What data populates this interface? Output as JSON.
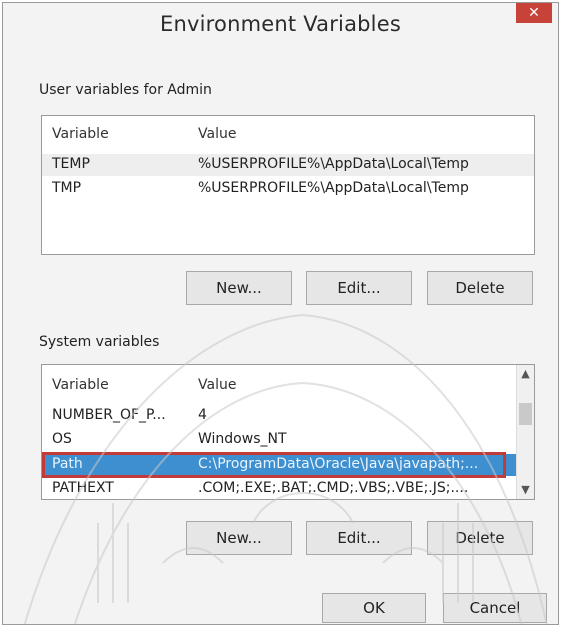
{
  "window": {
    "title": "Environment Variables",
    "close_glyph": "✕"
  },
  "user_section": {
    "label": "User variables for Admin",
    "columns": [
      "Variable",
      "Value"
    ],
    "rows": [
      {
        "variable": "TEMP",
        "value": "%USERPROFILE%\\AppData\\Local\\Temp"
      },
      {
        "variable": "TMP",
        "value": "%USERPROFILE%\\AppData\\Local\\Temp"
      }
    ],
    "buttons": {
      "new": "New...",
      "edit": "Edit...",
      "delete": "Delete"
    }
  },
  "system_section": {
    "label": "System variables",
    "columns": [
      "Variable",
      "Value"
    ],
    "rows": [
      {
        "variable": "NUMBER_OF_P...",
        "value": "4"
      },
      {
        "variable": "OS",
        "value": "Windows_NT"
      },
      {
        "variable": "Path",
        "value": "C:\\ProgramData\\Oracle\\Java\\javapath;..."
      },
      {
        "variable": "PATHEXT",
        "value": ".COM;.EXE;.BAT;.CMD;.VBS;.VBE;.JS;...."
      }
    ],
    "selected_row": "Path",
    "buttons": {
      "new": "New...",
      "edit": "Edit...",
      "delete": "Delete"
    }
  },
  "footer": {
    "ok": "OK",
    "cancel": "Cancel"
  },
  "colors": {
    "selection": "#3d8fcf",
    "highlight_outline": "#c23a3a",
    "close_button": "#c7433a"
  },
  "icons": {
    "close": "close-icon",
    "scroll_up": "chevron-up-icon",
    "scroll_down": "chevron-down-icon"
  }
}
